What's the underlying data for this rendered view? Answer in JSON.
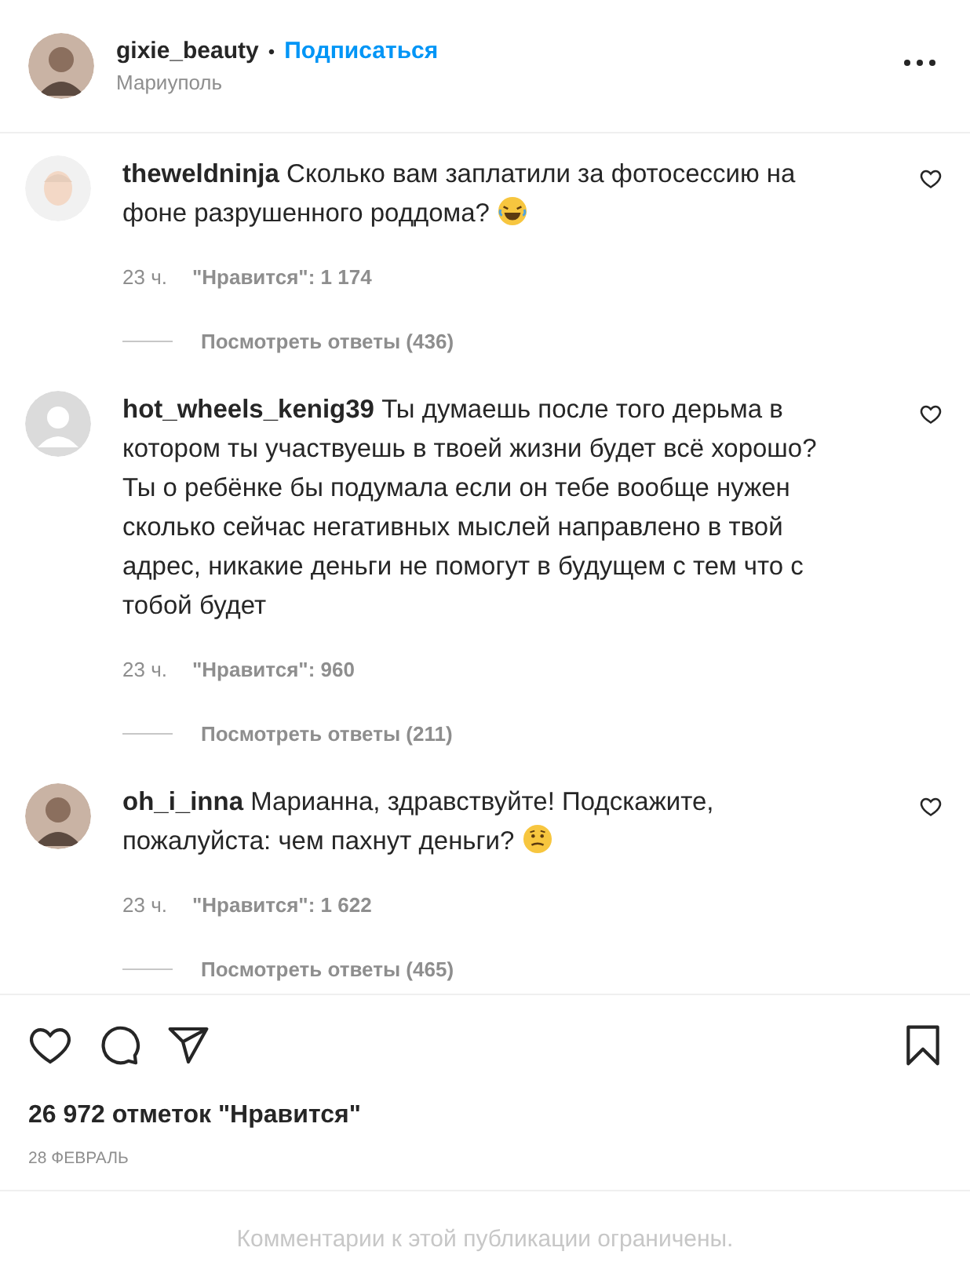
{
  "post_header": {
    "username": "gixie_beauty",
    "separator": "•",
    "follow_link": "Подписаться",
    "location": "Мариуполь",
    "avatar": {
      "kind": "photo"
    }
  },
  "comments": [
    {
      "avatar": {
        "kind": "memoji"
      },
      "username": "theweldninja",
      "text": "Сколько вам заплатили за фотосессию на фоне разрушенного роддома?",
      "emoji": {
        "kind": "laughing"
      },
      "time": "23 ч.",
      "likes": "\"Нравится\": 1 174",
      "replies": "Посмотреть ответы (436)",
      "liked": false
    },
    {
      "avatar": {
        "kind": "default"
      },
      "username": "hot_wheels_kenig39",
      "text": "Ты думаешь после того дерьма в котором ты участвуешь в твоей жизни будет всё хорошо? Ты о ребёнке бы подумала если он тебе вообще нужен сколько сейчас негативных мыслей направлено в твой адрес, никакие деньги не помогут в будущем с тем что с тобой будет",
      "time": "23 ч.",
      "likes": "\"Нравится\": 960",
      "replies": "Посмотреть ответы (211)",
      "liked": false
    },
    {
      "avatar": {
        "kind": "photo"
      },
      "username": "oh_i_inna",
      "text": "Марианна, здравствуйте! Подскажите, пожалуйста: чем пахнут деньги?",
      "emoji": {
        "kind": "confused"
      },
      "time": "23 ч.",
      "likes": "\"Нравится\": 1 622",
      "replies": "Посмотреть ответы (465)",
      "liked": false
    }
  ],
  "actions": {
    "liked": false,
    "saved": false
  },
  "like_count": "26 972 отметок \"Нравится\"",
  "date": "28 ФЕВРАЛЬ",
  "comments_notice": "Комментарии к этой публикации ограничены."
}
